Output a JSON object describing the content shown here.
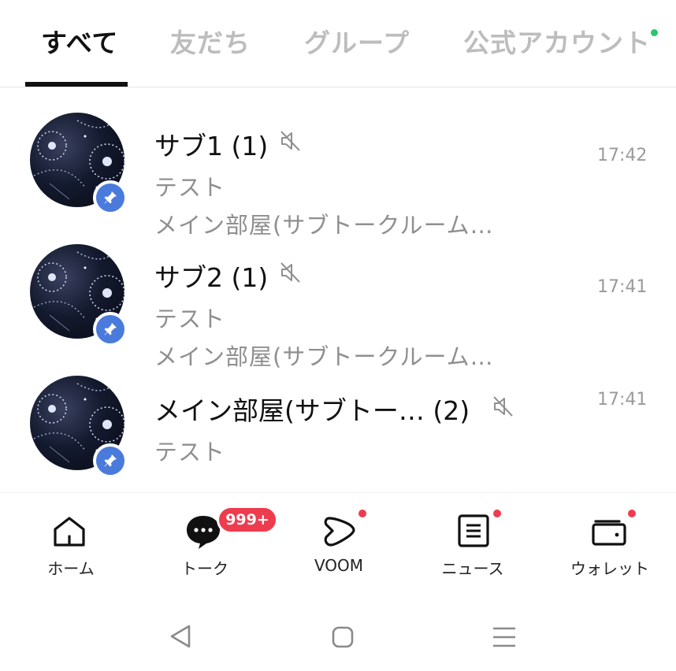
{
  "tabs": [
    {
      "label": "すべて",
      "active": true
    },
    {
      "label": "友だち",
      "active": false
    },
    {
      "label": "グループ",
      "active": false
    },
    {
      "label": "公式アカウント",
      "active": false,
      "has_new_dot": true
    }
  ],
  "chats": [
    {
      "title": "サブ1 (1)",
      "line1": "テスト",
      "line2": "メイン部屋(サブトークルーム…",
      "time": "17:42",
      "muted": true,
      "pinned": true
    },
    {
      "title": "サブ2 (1)",
      "line1": "テスト",
      "line2": "メイン部屋(サブトークルーム…",
      "time": "17:41",
      "muted": true,
      "pinned": true
    },
    {
      "title": "メイン部屋(サブトー… (2)",
      "line1": "テスト",
      "time": "17:41",
      "muted": true,
      "pinned": true
    }
  ],
  "bottom_nav": [
    {
      "label": "ホーム",
      "icon": "home-icon"
    },
    {
      "label": "トーク",
      "icon": "chat-bubble-icon",
      "badge": "999+"
    },
    {
      "label": "VOOM",
      "icon": "voom-icon",
      "has_dot": true
    },
    {
      "label": "ニュース",
      "icon": "news-icon",
      "has_dot": true
    },
    {
      "label": "ウォレット",
      "icon": "wallet-icon",
      "has_dot": true
    }
  ],
  "system_nav": [
    "back-icon",
    "home-circle-icon",
    "recent-apps-icon"
  ],
  "colors": {
    "accent_blue": "#4a7bdc",
    "badge_red": "#ee3c4f",
    "online_green": "#28c76f",
    "muted_text": "#8f8f8f"
  }
}
